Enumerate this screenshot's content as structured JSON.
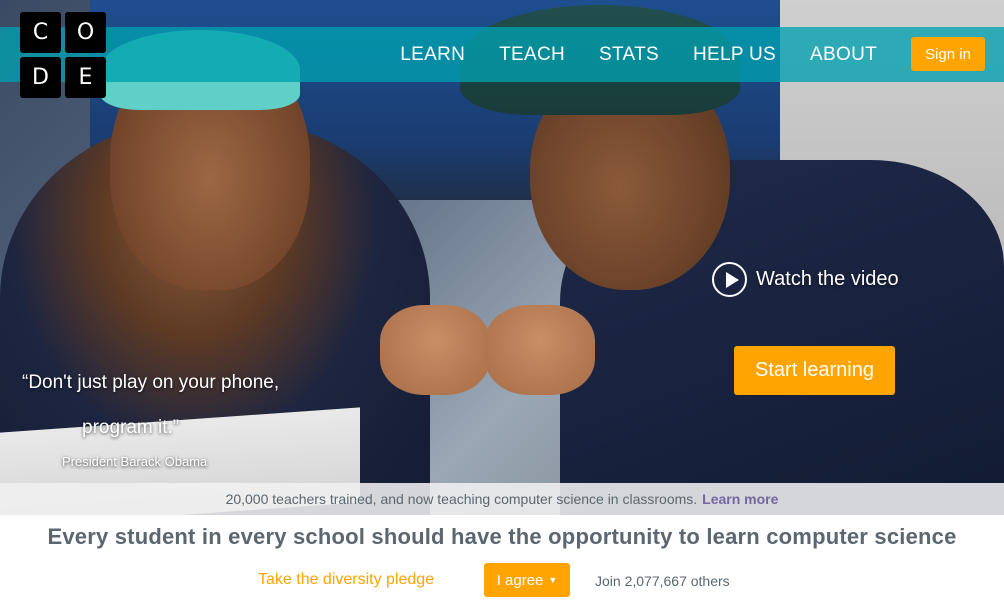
{
  "logo": {
    "letters": [
      "C",
      "O",
      "D",
      "E"
    ]
  },
  "nav": {
    "links": [
      "LEARN",
      "TEACH",
      "STATS",
      "HELP US",
      "ABOUT"
    ],
    "signin_label": "Sign in"
  },
  "hero": {
    "quote_line1": "“Don't just play on your phone,",
    "quote_line2": "program it.”",
    "attribution": "President Barack Obama",
    "watch_label": "Watch the video",
    "start_label": "Start learning"
  },
  "stat_strip": {
    "text": "20,000 teachers trained, and now teaching computer science in classrooms.",
    "link": "Learn more"
  },
  "bottom": {
    "tagline": "Every student in every school should have the opportunity to learn computer science",
    "pledge_label": "Take the diversity pledge",
    "agree_label": "I agree",
    "join_text": "Join 2,077,667 others"
  },
  "colors": {
    "accent_orange": "#ffa400",
    "nav_teal": "#00a0af",
    "text_gray": "#5b6770",
    "link_purple": "#7665a0"
  },
  "icons": [
    "play-icon",
    "caret-down-icon"
  ]
}
